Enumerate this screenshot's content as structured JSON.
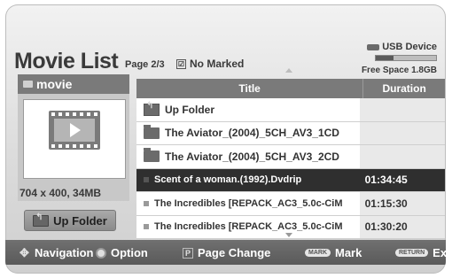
{
  "header": {
    "title": "Movie List",
    "page_indicator": "Page 2/3",
    "mark_status": "No Marked",
    "device_label": "USB Device",
    "free_space": "Free Space 1.8GB",
    "free_space_used_fraction": 0.3
  },
  "folder_panel": {
    "folder_name": "movie",
    "resolution": "704 x 400, 34MB",
    "up_folder_button": "Up Folder"
  },
  "table": {
    "columns": [
      "Title",
      "Duration"
    ],
    "rows": [
      {
        "title": "Up Folder",
        "duration": "",
        "type": "up"
      },
      {
        "title": "The Aviator_(2004)_5CH_AV3_1CD",
        "duration": "",
        "type": "folder"
      },
      {
        "title": "The Aviator_(2004)_5CH_AV3_2CD",
        "duration": "",
        "type": "folder"
      },
      {
        "title": "Scent of a woman.(1992).Dvdrip",
        "duration": "01:34:45",
        "type": "file",
        "selected": true
      },
      {
        "title": "The Incredibles [REPACK_AC3_5.0c-CiM",
        "duration": "01:15:30",
        "type": "file"
      },
      {
        "title": "The Incredibles [REPACK_AC3_5.0c-CiM",
        "duration": "01:30:20",
        "type": "file"
      }
    ]
  },
  "footer": {
    "navigation": "Navigation",
    "option": "Option",
    "page_change": "Page Change",
    "mark_key": "MARK",
    "mark": "Mark",
    "return_key": "RETURN",
    "exit": "Exit"
  },
  "colors": {
    "header_bar": "#7a7a7a",
    "selected_row": "#2f2f2f",
    "footer": "#606060"
  }
}
